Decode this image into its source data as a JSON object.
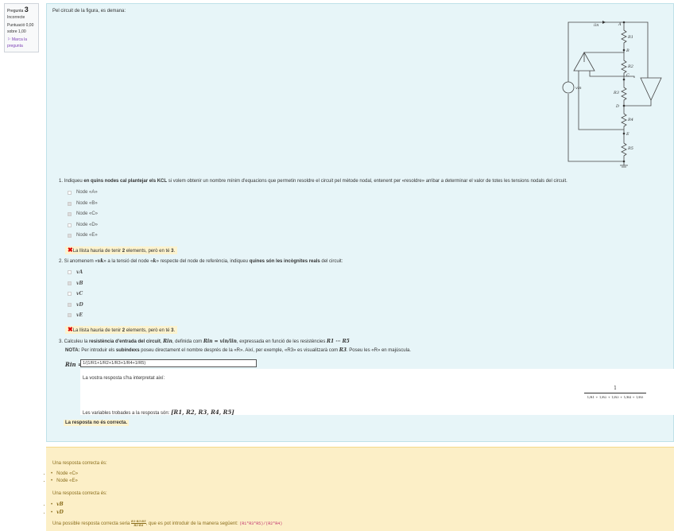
{
  "info": {
    "question_label": "Pregunta",
    "question_number": "3",
    "status": "Incorrecte",
    "score": "Puntuació 0,00",
    "score_of": "sobre 1,00",
    "flag": "Marca la pregunta"
  },
  "intro": "Pel circuit de la figura, es demana:",
  "circuit": {
    "labels": {
      "iin": "iin",
      "vin": "vin",
      "A": "A",
      "B": "B",
      "C": "C",
      "D": "D",
      "E": "E",
      "R1": "R1",
      "R2": "R2",
      "R3": "R3",
      "R4": "R4",
      "R5": "R5"
    }
  },
  "q1": {
    "pre": "1. Indiqueu ",
    "bold": "en quins nodes cal plantejar els KCL",
    "post": " si volem obtenir un nombre mínim d'equacions que permetin resoldre el circuit pel mètode nodal, entenent per «resoldre» arribar a determinar el valor de totes les tensions nodals del circuit.",
    "options": [
      {
        "label": "Node «A»",
        "checked": false
      },
      {
        "label": "Node «B»",
        "checked": true
      },
      {
        "label": "Node «C»",
        "checked": true
      },
      {
        "label": "Node «D»",
        "checked": false
      },
      {
        "label": "Node «E»",
        "checked": true
      }
    ],
    "feedback_pre": "La llista hauria de tenir ",
    "feedback_n1": "2",
    "feedback_mid": " elements, però en té ",
    "feedback_n2": "3",
    "feedback_end": "."
  },
  "q2": {
    "pre": "2. Si anomenem «",
    "var": "vk",
    "mid": "» a la tensió del node «",
    "k": "k",
    "mid2": "» respecte del node de referència, indiqueu ",
    "bold": "quines són les incògnites reals",
    "post": " del circuit:",
    "options": [
      {
        "label": "vA",
        "checked": false
      },
      {
        "label": "vB",
        "checked": true
      },
      {
        "label": "vC",
        "checked": false
      },
      {
        "label": "vD",
        "checked": true
      },
      {
        "label": "vE",
        "checked": true
      }
    ],
    "feedback_pre": "La llista hauria de tenir ",
    "feedback_n1": "2",
    "feedback_mid": " elements, però en té ",
    "feedback_n2": "3",
    "feedback_end": "."
  },
  "q3": {
    "pre": "3. Calculeu la ",
    "bold": "resistència d'entrada del circuit",
    "mid": ", ",
    "rin": "Rin",
    "mid2": ", definida com ",
    "def": "Rin = vin/iin",
    "post": ", expressada en funció de les resistències ",
    "range": "R1 ··· R5",
    "note_label": "NOTA:",
    "note": " Per introduir els ",
    "note_bold": "subíndexs",
    "note2": " poseu directament el nombre després de la «R». Així, per exemple, «R3» es visualitzarà com ",
    "r3": "R3",
    "note3": ". Poseu les «R» en majúscula.",
    "input_label": "Rin =",
    "input_value": "1/(1/R1+1/R2+1/R3+1/R4+1/R5)",
    "interp_label": "La vostra resposta s'ha interpretat així:",
    "interp_num": "1",
    "interp_den": "1/R1 + 1/R2 + 1/R3 + 1/R4 + 1/R5",
    "vars_label": "Les variables trobades a la resposta són: ",
    "vars": "[R1, R2, R3, R4, R5]",
    "result": "La resposta no és correcta."
  },
  "answers": {
    "a1_label": "Una resposta correcta és:",
    "a1": [
      "Node «C»",
      "Node «E»"
    ],
    "a2_label": "Una resposta correcta és:",
    "a2": [
      "vB",
      "vD"
    ],
    "a3_pre": "Una possible resposta correcta seria ",
    "a3_frac_num": "R1·R3·R5",
    "a3_frac_den": "R2·R4",
    "a3_mid": ", que es pot introduir de la manera següent: ",
    "a3_code": "(R1*R3*R5)/(R2*R4)"
  }
}
